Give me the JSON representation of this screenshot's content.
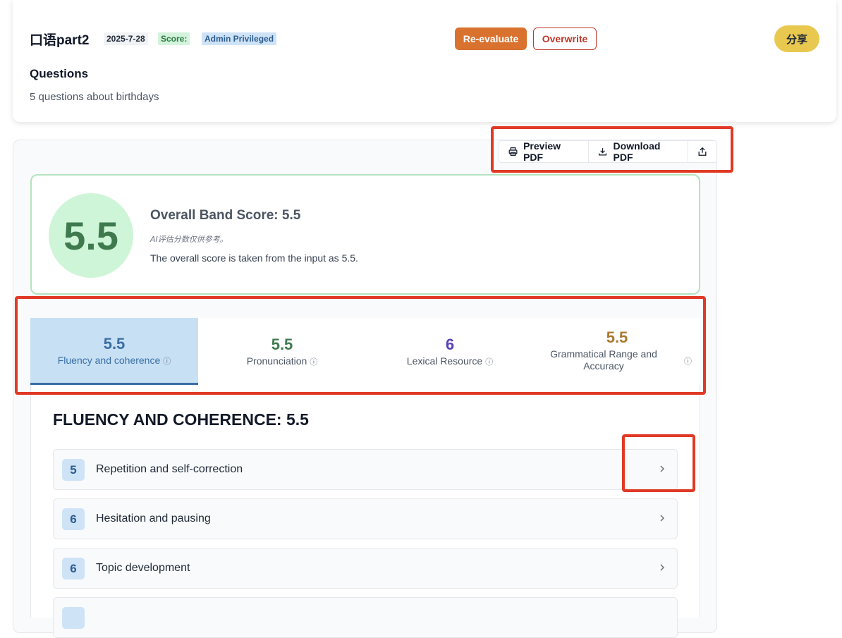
{
  "header": {
    "title": "口语part2",
    "date": "2025-7-28",
    "score_label": "Score:",
    "admin_badge": "Admin Privileged",
    "reevaluate_label": "Re-evaluate",
    "overwrite_label": "Overwrite",
    "share_label": "分享",
    "questions_heading": "Questions",
    "questions_text": "5 questions about birthdays"
  },
  "toolbar": {
    "preview_pdf": "Preview PDF",
    "download_pdf": "Download PDF"
  },
  "overall": {
    "score": "5.5",
    "title": "Overall Band Score: 5.5",
    "note": "AI评估分数仅供参考。",
    "description": "The overall score is taken from the input as 5.5."
  },
  "tabs": [
    {
      "score": "5.5",
      "label": "Fluency and coherence",
      "color": "#3a6ea5",
      "active": true
    },
    {
      "score": "5.5",
      "label": "Pronunciation",
      "color": "#3f7a4f",
      "active": false
    },
    {
      "score": "6",
      "label": "Lexical Resource",
      "color": "#5b3fb5",
      "active": false
    },
    {
      "score": "5.5",
      "label": "Grammatical Range and Accuracy",
      "color": "#a8792e",
      "active": false
    }
  ],
  "criteria": {
    "heading": "FLUENCY AND COHERENCE: 5.5",
    "items": [
      {
        "score": "5",
        "label": "Repetition and self-correction"
      },
      {
        "score": "6",
        "label": "Hesitation and pausing"
      },
      {
        "score": "6",
        "label": "Topic development"
      }
    ]
  },
  "colors": {
    "accent_orange": "#d9722e",
    "overwrite_red": "#c0392b",
    "share_yellow": "#e9c84f",
    "highlight_red": "#e03a26"
  },
  "icons": {
    "preview": "printer-icon",
    "download": "download-icon",
    "share": "share-upload-icon",
    "expand": "chevron-right-icon",
    "info": "info-icon"
  }
}
